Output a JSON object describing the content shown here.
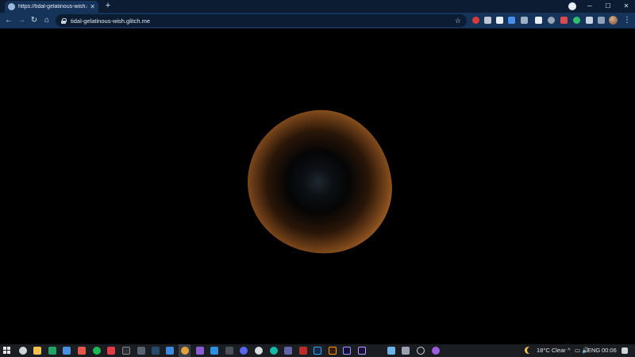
{
  "browser": {
    "tab_title": "https://tidal-gelatinous-wish.glitch.me",
    "tab_close": "✕",
    "new_tab": "+",
    "url": "tidal-gelatinous-wish.glitch.me",
    "window_controls": {
      "minimize": "─",
      "maximize": "☐",
      "close": "✕"
    },
    "nav": {
      "back": "←",
      "forward": "→",
      "reload": "↻",
      "home": "⌂"
    },
    "star": "☆",
    "menu": "⋮",
    "extension_icons": [
      "red-extension-icon",
      "gray-extension-icon",
      "doc-extension-icon",
      "blue-extension-icon",
      "pen-extension-icon",
      "green-extension-icon",
      "shield-extension-icon",
      "red-flag-extension-icon",
      "puzzle-extension-icon",
      "list-extension-icon"
    ]
  },
  "page": {
    "content": "orange-glowing-blob",
    "colors": {
      "outer": "#d48840",
      "mid": "#7a461a",
      "core": "#050505",
      "center": "#1d2730"
    }
  },
  "taskbar": {
    "icons": [
      "windows-start-icon",
      "search-icon",
      "file-explorer-icon",
      "sheets-icon",
      "photos-icon",
      "spotify-icon",
      "app-red-icon",
      "app-dark-icon",
      "app-blue-icon",
      "terminal-icon",
      "steam-icon",
      "mail-icon",
      "chrome-icon",
      "visual-studio-icon",
      "vscode-icon",
      "app-git-icon",
      "discord-icon",
      "app-circle-icon",
      "teams-icon",
      "filezilla-icon",
      "photoshop-icon",
      "illustrator-icon",
      "premiere-icon",
      "after-effects-icon",
      "app-box-icon",
      "app-anim-icon",
      "app-ring-icon",
      "app-purple-icon"
    ],
    "weather": "18°C  Clear",
    "tray_chevron": "^",
    "tray_icons": "▭ 🔊",
    "language": "ENG",
    "time": "00:06"
  }
}
